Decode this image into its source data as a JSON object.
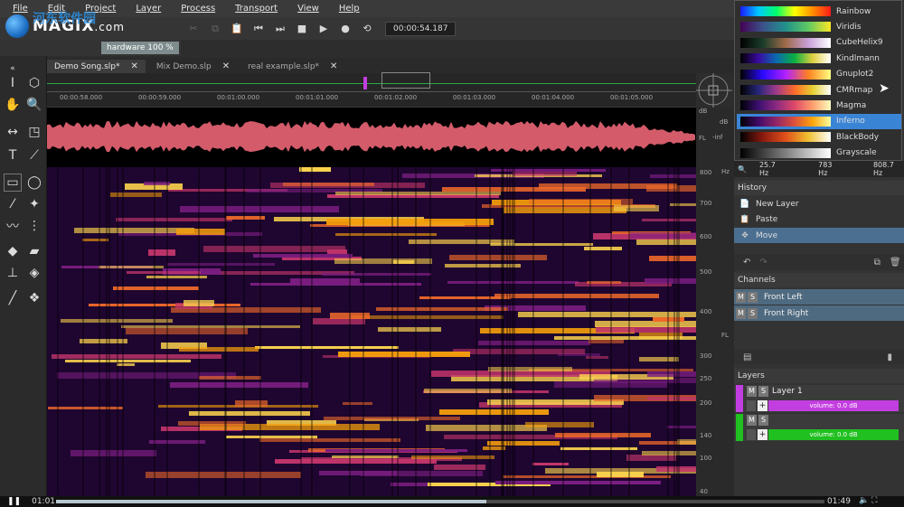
{
  "menu": [
    "File",
    "Edit",
    "Project",
    "Layer",
    "Process",
    "Transport",
    "View",
    "Help"
  ],
  "logo": {
    "brand": "MAGIX",
    "suffix": ".com",
    "watermark": "河东软件园"
  },
  "transport": {
    "time": "00:00:54.187"
  },
  "toolbar2": {
    "hardware": "hardware 100 %"
  },
  "tabs": [
    {
      "label": "Demo Song.slp*",
      "active": true
    },
    {
      "label": "Mix Demo.slp",
      "active": false
    },
    {
      "label": "real example.slp*",
      "active": false
    }
  ],
  "ruler_ticks": [
    "00:00:58.000",
    "00:00:59.000",
    "00:01:00.000",
    "00:01:01.000",
    "00:01:02.000",
    "00:01:03.000",
    "00:01:04.000",
    "00:01:05.000"
  ],
  "wave_scale": {
    "db": "dB",
    "inf": "-inf",
    "fl": "FL"
  },
  "spec_scale": {
    "unit": "Hz",
    "labels": [
      "800",
      "700",
      "600",
      "500",
      "400",
      "300",
      "250",
      "200",
      "140",
      "100",
      "40"
    ],
    "fl": "FL"
  },
  "colormaps": [
    {
      "name": "Rainbow",
      "gradient": "linear-gradient(90deg,#1a1aff,#00c8ff,#00ff6a,#ffff00,#ff8c00,#ff1a1a)",
      "selected": false
    },
    {
      "name": "Viridis",
      "gradient": "linear-gradient(90deg,#440154,#3b528b,#21918c,#5ec962,#fde725)",
      "selected": false
    },
    {
      "name": "CubeHelix9",
      "gradient": "linear-gradient(90deg,#000,#1a3d2a,#a06a4a,#c8a0d8,#fff)",
      "selected": false
    },
    {
      "name": "Kindlmann",
      "gradient": "linear-gradient(90deg,#000,#3a0aa0,#0a6ab0,#0ab040,#e0d040,#fff)",
      "selected": false
    },
    {
      "name": "Gnuplot2",
      "gradient": "linear-gradient(90deg,#000,#2a0aff,#b020ff,#ff8020,#ffff80)",
      "selected": false
    },
    {
      "name": "CMRmap",
      "gradient": "linear-gradient(90deg,#000,#26267a,#a03a8a,#ff6a2a,#e6d030,#fff)",
      "selected": false
    },
    {
      "name": "Magma",
      "gradient": "linear-gradient(90deg,#000004,#3b0f70,#8c2981,#de4968,#fe9f6d,#fcfdbf)",
      "selected": false
    },
    {
      "name": "Inferno",
      "gradient": "linear-gradient(90deg,#000004,#420a68,#932667,#dd513a,#fca50a,#fcffa4)",
      "selected": true
    },
    {
      "name": "BlackBody",
      "gradient": "linear-gradient(90deg,#000,#8a1a10,#e0501a,#f0c030,#fff)",
      "selected": false
    },
    {
      "name": "Grayscale",
      "gradient": "linear-gradient(90deg,#000,#fff)",
      "selected": false
    }
  ],
  "freqbar": {
    "f1": "25.7 Hz",
    "f2": "783 Hz",
    "f3": "808.7 Hz"
  },
  "history": {
    "title": "History",
    "items": [
      {
        "label": "New Layer",
        "icon": "📄",
        "selected": false
      },
      {
        "label": "Paste",
        "icon": "📋",
        "selected": false
      },
      {
        "label": "Move",
        "icon": "✥",
        "selected": true
      }
    ]
  },
  "channels": {
    "title": "Channels",
    "items": [
      "Front Left",
      "Front Right"
    ]
  },
  "layers": {
    "title": "Layers",
    "items": [
      {
        "name": "Layer 1",
        "volume": "volume: 0.0 dB",
        "color": "#c33ee0"
      },
      {
        "name": "",
        "volume": "volume: 0.0 dB",
        "color": "#20c020"
      }
    ]
  },
  "player": {
    "current": "01:01",
    "total": "01:49",
    "progress": 0.56
  }
}
